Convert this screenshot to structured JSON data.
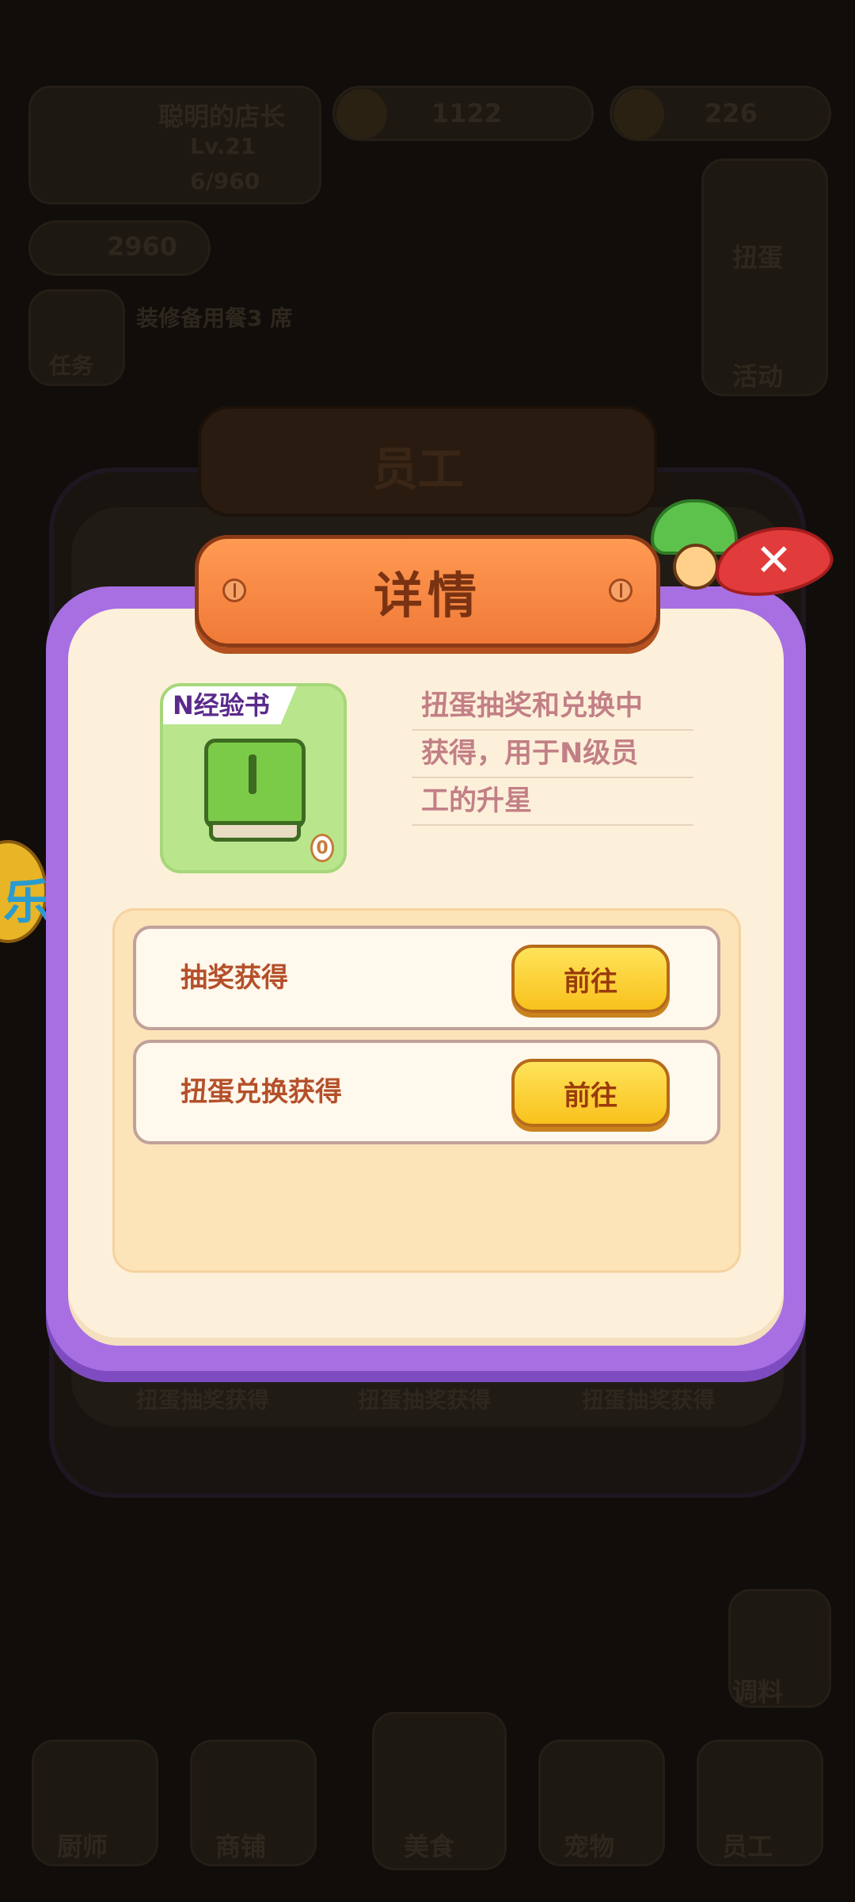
{
  "background": {
    "player_name": "聪明的店长",
    "player_level": "Lv.21",
    "exp": "6/960",
    "currency_1": "1122",
    "currency_2": "226",
    "stars": "2960",
    "task_label": "任务",
    "task_text": "装修备用餐3 席",
    "right_buttons": [
      "扭蛋",
      "活动"
    ],
    "panel_title": "员工",
    "row_labels": [
      "扭蛋抽奖获得",
      "扭蛋抽奖获得",
      "扭蛋抽奖获得"
    ],
    "bottom_nav": [
      "厨师",
      "商铺",
      "美食",
      "宠物",
      "员工"
    ],
    "side_right": "调料"
  },
  "modal": {
    "title": "详情",
    "close_icon": "✕",
    "item": {
      "tag": "N经验书",
      "count": "0",
      "icon": "green-book-icon"
    },
    "description_lines": [
      "扭蛋抽奖和兑换中",
      "获得，用于N级员",
      "工的升星"
    ],
    "sources": [
      {
        "label": "抽奖获得",
        "button": "前往"
      },
      {
        "label": "扭蛋兑换获得",
        "button": "前往"
      }
    ]
  },
  "side_badge_glyph": "乐"
}
